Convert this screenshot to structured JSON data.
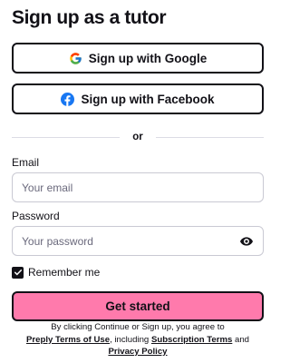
{
  "page": {
    "title": "Sign up as a tutor"
  },
  "sso": {
    "google_label": "Sign up with Google",
    "facebook_label": "Sign up with Facebook"
  },
  "divider": {
    "label": "or"
  },
  "form": {
    "email_label": "Email",
    "email_placeholder": "Your email",
    "email_value": "",
    "password_label": "Password",
    "password_placeholder": "Your password",
    "password_value": "",
    "remember_label": "Remember me",
    "remember_checked": true,
    "submit_label": "Get started"
  },
  "legal": {
    "prefix": "By clicking Continue or Sign up, you agree to",
    "terms_link": "Preply Terms of Use",
    "including": ", including",
    "subscription_link": "Subscription Terms",
    "and": "and",
    "privacy_link": "Privacy Policy"
  },
  "icons": {
    "google": "google-logo-icon",
    "facebook": "facebook-logo-icon",
    "password_toggle": "eye-icon",
    "checkbox": "checkmark-icon"
  },
  "colors": {
    "primary_button": "#ff7aac",
    "text": "#121117",
    "facebook_blue": "#1877f2"
  }
}
